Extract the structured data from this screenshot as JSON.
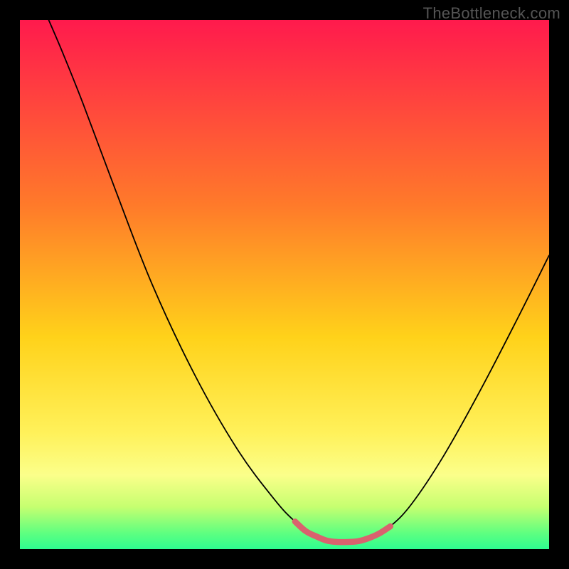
{
  "watermark": "TheBottleneck.com",
  "chart_data": {
    "type": "line",
    "title": "",
    "xlabel": "",
    "ylabel": "",
    "xlim": [
      0,
      100
    ],
    "ylim": [
      0,
      100
    ],
    "background_gradient_stops": [
      {
        "offset": 0.0,
        "color": "#ff1a4d"
      },
      {
        "offset": 0.35,
        "color": "#ff7a2a"
      },
      {
        "offset": 0.6,
        "color": "#ffd21a"
      },
      {
        "offset": 0.78,
        "color": "#fff15a"
      },
      {
        "offset": 0.86,
        "color": "#fbff8a"
      },
      {
        "offset": 0.92,
        "color": "#c6ff70"
      },
      {
        "offset": 0.97,
        "color": "#5eff80"
      },
      {
        "offset": 1.0,
        "color": "#2efc90"
      }
    ],
    "series": [
      {
        "name": "bottleneck-curve",
        "color": "#000000",
        "width": 1.8,
        "points": [
          {
            "x": 5.0,
            "y": 101.0
          },
          {
            "x": 8.0,
            "y": 94.0
          },
          {
            "x": 12.0,
            "y": 84.0
          },
          {
            "x": 18.0,
            "y": 68.0
          },
          {
            "x": 25.0,
            "y": 50.0
          },
          {
            "x": 33.0,
            "y": 33.0
          },
          {
            "x": 41.0,
            "y": 19.0
          },
          {
            "x": 48.0,
            "y": 9.5
          },
          {
            "x": 52.0,
            "y": 5.2
          },
          {
            "x": 55.5,
            "y": 2.6
          },
          {
            "x": 58.0,
            "y": 1.6
          },
          {
            "x": 61.0,
            "y": 1.3
          },
          {
            "x": 64.0,
            "y": 1.5
          },
          {
            "x": 67.0,
            "y": 2.4
          },
          {
            "x": 70.0,
            "y": 4.3
          },
          {
            "x": 74.0,
            "y": 8.5
          },
          {
            "x": 80.0,
            "y": 17.5
          },
          {
            "x": 87.0,
            "y": 30.0
          },
          {
            "x": 94.0,
            "y": 43.5
          },
          {
            "x": 100.0,
            "y": 55.5
          }
        ]
      },
      {
        "name": "optimal-zone-highlight",
        "color": "#d9626e",
        "width": 8.5,
        "points": [
          {
            "x": 52.0,
            "y": 5.2
          },
          {
            "x": 54.0,
            "y": 3.4
          },
          {
            "x": 56.0,
            "y": 2.4
          },
          {
            "x": 58.0,
            "y": 1.6
          },
          {
            "x": 60.0,
            "y": 1.35
          },
          {
            "x": 62.0,
            "y": 1.35
          },
          {
            "x": 64.0,
            "y": 1.5
          },
          {
            "x": 66.0,
            "y": 2.1
          },
          {
            "x": 68.0,
            "y": 3.0
          },
          {
            "x": 70.0,
            "y": 4.3
          }
        ]
      }
    ]
  }
}
